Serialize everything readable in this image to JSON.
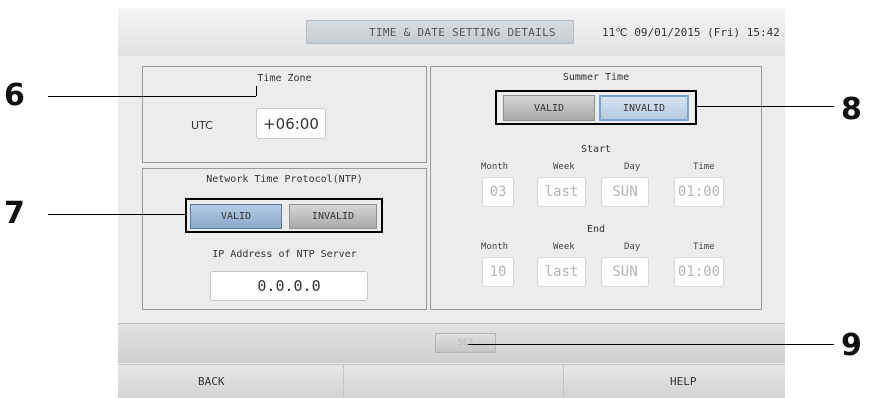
{
  "header": {
    "title": "TIME & DATE SETTING DETAILS",
    "status": "11℃ 09/01/2015 (Fri) 15:42"
  },
  "time_zone": {
    "title": "Time Zone",
    "prefix": "UTC",
    "offset": "+06:00"
  },
  "ntp": {
    "title": "Network Time Protocol(NTP)",
    "valid_label": "VALID",
    "invalid_label": "INVALID",
    "ip_label": "IP Address of NTP Server",
    "ip_value": "0.0.0.0"
  },
  "summer_time": {
    "title": "Summer Time",
    "valid_label": "VALID",
    "invalid_label": "INVALID",
    "start_label": "Start",
    "end_label": "End",
    "col_month": "Month",
    "col_week": "Week",
    "col_day": "Day",
    "col_time": "Time",
    "start": {
      "month": "03",
      "week": "last",
      "day": "SUN",
      "time": "01:00"
    },
    "end": {
      "month": "10",
      "week": "last",
      "day": "SUN",
      "time": "01:00"
    }
  },
  "set_label": "SET",
  "footer": {
    "back_label": "BACK",
    "help_label": "HELP"
  },
  "callouts": [
    "6",
    "7",
    "8",
    "9"
  ]
}
